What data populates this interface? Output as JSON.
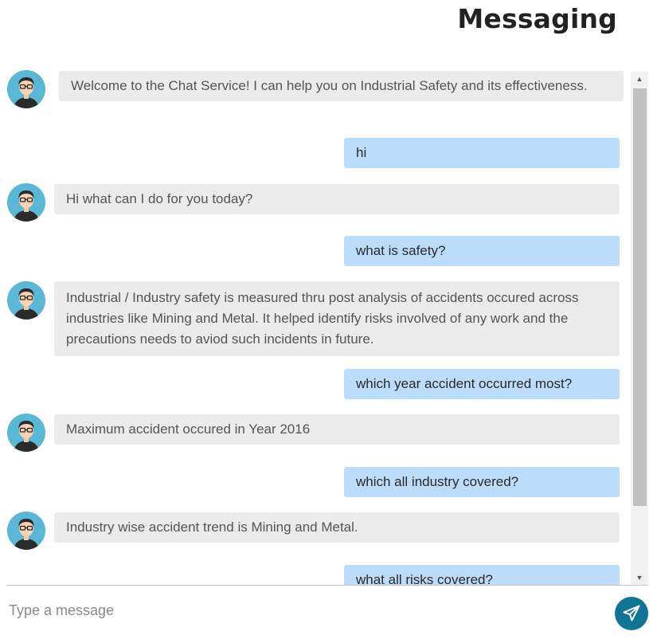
{
  "header": {
    "title": "Messaging"
  },
  "messages": [
    {
      "sender": "bot",
      "text": "Welcome to the Chat Service! I can help you on Industrial Safety and its effectiveness."
    },
    {
      "sender": "user",
      "text": "hi"
    },
    {
      "sender": "bot",
      "text": "Hi what can I do for you today?"
    },
    {
      "sender": "user",
      "text": "what is safety?"
    },
    {
      "sender": "bot",
      "text": "Industrial / Industry safety is measured thru post analysis of accidents occured across industries like Mining and Metal. It helped identify risks involved of any work and the precautions needs to aviod such incidents in future."
    },
    {
      "sender": "user",
      "text": "which year accident occurred most?"
    },
    {
      "sender": "bot",
      "text": "Maximum accident occured in Year 2016"
    },
    {
      "sender": "user",
      "text": "which all industry covered?"
    },
    {
      "sender": "bot",
      "text": "Industry wise accident trend is Mining and Metal."
    },
    {
      "sender": "user",
      "text": "what all risks covered?"
    }
  ],
  "composer": {
    "placeholder": "Type a message",
    "value": ""
  },
  "colors": {
    "bot_bubble": "#ebebeb",
    "user_bubble": "#bbdcfa",
    "send_button": "#0f7495",
    "avatar_bg": "#5bb7d6"
  },
  "icons": {
    "avatar": "user-avatar-icon",
    "send": "paper-plane-icon",
    "scroll_up": "scroll-up-arrow-icon",
    "scroll_down": "scroll-down-arrow-icon"
  }
}
